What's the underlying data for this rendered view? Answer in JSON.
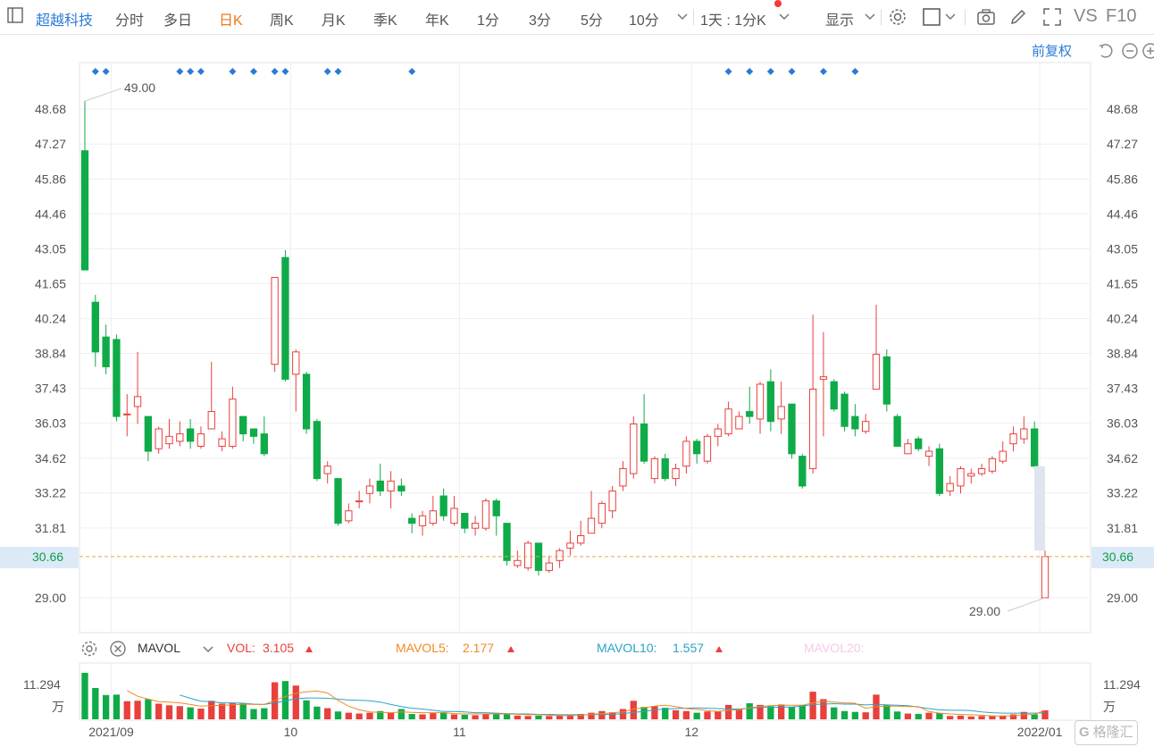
{
  "toolbar": {
    "stock_name": "超越科技",
    "periods": [
      "分时",
      "多日",
      "日K",
      "周K",
      "月K",
      "季K",
      "年K",
      "1分",
      "3分",
      "5分",
      "10分"
    ],
    "selected_period": "日K",
    "interval_select": "1天 : 1分K",
    "display_label": "显示",
    "vs_label": "VS",
    "f10_label": "F10"
  },
  "sub_header": {
    "adjust_label": "前复权"
  },
  "indicator": {
    "name": "MAVOL",
    "vol_label": "VOL:",
    "vol_value": "3.105",
    "mavol5_label": "MAVOL5:",
    "mavol5_value": "2.177",
    "mavol10_label": "MAVOL10:",
    "mavol10_value": "1.557",
    "mavol20_label": "MAVOL20:",
    "volume_max_label": "11.294",
    "volume_unit": "万"
  },
  "current_price_label": "30.66",
  "high_marker_label": "49.00",
  "low_marker_label": "29.00",
  "watermark": "格隆汇",
  "colors": {
    "up": "#e8403c",
    "down": "#0fab49",
    "mavol5": "#f08a24",
    "mavol10": "#2aa3c8",
    "mavol20": "#f7c9e6",
    "accent": "#2b7bd6",
    "selected": "#f07a1a",
    "price_line": "#f0a040"
  },
  "chart_data": {
    "type": "candlestick",
    "y_ticks": [
      48.68,
      47.27,
      45.86,
      44.46,
      43.05,
      41.65,
      40.24,
      38.84,
      37.43,
      36.03,
      34.62,
      33.22,
      31.81,
      29.0
    ],
    "ylim": [
      28.15,
      50.0
    ],
    "x_labels": [
      "2021/09",
      "10",
      "11",
      "12",
      "2022/01"
    ],
    "x_label_index": [
      3,
      20,
      36,
      58,
      91
    ],
    "current_price": 30.66,
    "high": 49.0,
    "low": 29.0,
    "candles": [
      [
        47.0,
        42.2,
        49.0,
        42.2
      ],
      [
        40.9,
        38.9,
        41.2,
        38.3
      ],
      [
        39.5,
        38.3,
        40.0,
        38.0
      ],
      [
        39.4,
        36.3,
        39.6,
        36.1
      ],
      [
        36.4,
        36.4,
        37.2,
        35.5
      ],
      [
        36.7,
        37.1,
        38.9,
        36.0
      ],
      [
        36.3,
        34.9,
        36.3,
        34.5
      ],
      [
        35.0,
        35.8,
        35.9,
        34.8
      ],
      [
        35.2,
        35.5,
        36.2,
        35.0
      ],
      [
        35.3,
        35.6,
        36.1,
        35.1
      ],
      [
        35.8,
        35.3,
        36.2,
        35.0
      ],
      [
        35.1,
        35.6,
        35.9,
        35.0
      ],
      [
        35.8,
        36.5,
        38.5,
        35.9
      ],
      [
        35.1,
        35.4,
        35.7,
        34.9
      ],
      [
        35.1,
        37.0,
        37.5,
        35.0
      ],
      [
        36.3,
        35.6,
        36.3,
        35.3
      ],
      [
        35.8,
        35.5,
        35.8,
        35.2
      ],
      [
        35.6,
        34.8,
        36.3,
        34.7
      ],
      [
        38.4,
        41.9,
        41.9,
        38.1
      ],
      [
        42.7,
        37.8,
        43.0,
        37.7
      ],
      [
        38.0,
        38.9,
        39.0,
        36.5
      ],
      [
        38.0,
        35.8,
        38.1,
        35.6
      ],
      [
        36.1,
        33.8,
        36.2,
        33.7
      ],
      [
        34.0,
        34.3,
        34.5,
        33.6
      ],
      [
        33.8,
        32.0,
        33.8,
        31.9
      ],
      [
        32.1,
        32.5,
        32.8,
        32.0
      ],
      [
        32.9,
        32.9,
        33.3,
        32.6
      ],
      [
        33.2,
        33.5,
        33.8,
        32.8
      ],
      [
        33.7,
        33.3,
        34.4,
        33.1
      ],
      [
        33.3,
        33.7,
        34.1,
        32.6
      ],
      [
        33.5,
        33.3,
        33.8,
        33.1
      ],
      [
        32.2,
        32.0,
        32.4,
        31.6
      ],
      [
        31.9,
        32.3,
        32.5,
        31.5
      ],
      [
        32.0,
        32.5,
        33.1,
        31.9
      ],
      [
        33.1,
        32.3,
        33.4,
        32.1
      ],
      [
        32.0,
        32.6,
        33.1,
        31.9
      ],
      [
        32.4,
        31.8,
        32.4,
        31.6
      ],
      [
        31.8,
        32.0,
        32.3,
        31.5
      ],
      [
        31.8,
        32.9,
        33.0,
        31.7
      ],
      [
        32.9,
        32.3,
        33.0,
        31.5
      ],
      [
        32.0,
        30.5,
        32.0,
        30.3
      ],
      [
        30.3,
        30.5,
        30.9,
        30.2
      ],
      [
        30.2,
        31.2,
        31.3,
        30.1
      ],
      [
        31.2,
        30.1,
        31.2,
        29.9
      ],
      [
        30.1,
        30.4,
        30.7,
        30.0
      ],
      [
        30.5,
        30.9,
        31.0,
        30.2
      ],
      [
        31.0,
        31.2,
        31.7,
        30.7
      ],
      [
        31.2,
        31.5,
        32.1,
        31.1
      ],
      [
        31.6,
        32.2,
        33.3,
        31.6
      ],
      [
        32.0,
        32.8,
        32.9,
        31.8
      ],
      [
        32.5,
        33.3,
        33.5,
        32.2
      ],
      [
        33.5,
        34.2,
        34.5,
        33.3
      ],
      [
        34.0,
        36.0,
        36.3,
        33.8
      ],
      [
        36.0,
        34.5,
        37.2,
        34.4
      ],
      [
        33.8,
        34.6,
        34.7,
        33.6
      ],
      [
        34.6,
        33.8,
        34.8,
        33.7
      ],
      [
        33.8,
        34.2,
        34.4,
        33.5
      ],
      [
        34.3,
        35.3,
        35.5,
        34.0
      ],
      [
        35.3,
        34.8,
        35.4,
        34.4
      ],
      [
        34.5,
        35.5,
        35.6,
        34.4
      ],
      [
        35.5,
        35.8,
        36.0,
        35.1
      ],
      [
        35.6,
        36.6,
        36.9,
        35.5
      ],
      [
        35.8,
        36.3,
        36.5,
        35.8
      ],
      [
        36.5,
        36.3,
        37.5,
        36.0
      ],
      [
        36.2,
        37.6,
        37.7,
        35.6
      ],
      [
        37.7,
        36.1,
        38.2,
        35.7
      ],
      [
        36.2,
        36.7,
        37.7,
        35.6
      ],
      [
        36.8,
        34.8,
        36.8,
        34.6
      ],
      [
        34.7,
        33.5,
        34.8,
        33.4
      ],
      [
        34.2,
        37.4,
        40.4,
        34.0
      ],
      [
        37.8,
        37.9,
        39.7,
        35.5
      ],
      [
        37.7,
        36.6,
        37.8,
        36.5
      ],
      [
        37.2,
        35.9,
        37.3,
        35.7
      ],
      [
        36.3,
        35.8,
        36.8,
        35.5
      ],
      [
        35.7,
        36.1,
        36.4,
        35.6
      ],
      [
        37.4,
        38.8,
        40.8,
        37.4
      ],
      [
        38.7,
        36.8,
        39.0,
        36.5
      ],
      [
        36.3,
        35.1,
        36.4,
        35.1
      ],
      [
        34.8,
        35.2,
        35.4,
        34.9
      ],
      [
        35.4,
        35.0,
        35.5,
        34.9
      ],
      [
        34.7,
        34.9,
        35.1,
        34.3
      ],
      [
        35.0,
        33.2,
        35.2,
        33.1
      ],
      [
        33.3,
        33.6,
        33.9,
        33.1
      ],
      [
        33.5,
        34.2,
        34.3,
        33.2
      ],
      [
        33.9,
        34.0,
        34.2,
        33.6
      ],
      [
        34.0,
        34.2,
        34.4,
        33.9
      ],
      [
        34.1,
        34.6,
        34.7,
        34.0
      ],
      [
        34.5,
        34.9,
        35.3,
        34.4
      ],
      [
        35.2,
        35.6,
        35.9,
        34.9
      ],
      [
        35.4,
        35.8,
        36.3,
        35.2
      ],
      [
        35.8,
        34.3,
        36.1,
        34.2
      ],
      [
        29.0,
        30.66,
        30.9,
        29.0
      ]
    ],
    "volume": [
      11.29,
      7.6,
      5.9,
      6.0,
      4.4,
      4.5,
      4.9,
      3.8,
      3.4,
      3.2,
      2.9,
      2.6,
      4.5,
      3.8,
      3.9,
      3.8,
      2.5,
      2.7,
      9.0,
      9.3,
      8.2,
      4.6,
      3.1,
      2.7,
      1.9,
      1.6,
      1.4,
      1.6,
      2.0,
      1.6,
      2.5,
      1.3,
      1.2,
      1.5,
      1.7,
      1.2,
      1.1,
      1.0,
      1.4,
      1.5,
      1.3,
      0.9,
      0.8,
      0.9,
      0.8,
      0.9,
      1.2,
      1.3,
      1.6,
      2.0,
      1.7,
      2.5,
      4.5,
      3.0,
      3.2,
      2.8,
      2.2,
      2.0,
      1.6,
      1.9,
      1.9,
      3.5,
      2.6,
      3.9,
      3.5,
      3.2,
      3.6,
      3.0,
      3.5,
      6.7,
      4.9,
      2.9,
      2.0,
      1.8,
      1.7,
      6.0,
      3.5,
      1.9,
      1.4,
      1.3,
      1.6,
      1.5,
      0.8,
      0.9,
      0.7,
      0.8,
      0.8,
      0.9,
      1.2,
      1.8,
      1.2,
      2.2
    ],
    "mavol5": [
      null,
      null,
      null,
      null,
      7.0,
      5.6,
      4.9,
      4.3,
      4.2,
      4.0,
      3.6,
      3.2,
      3.3,
      3.4,
      3.5,
      3.7,
      3.6,
      3.6,
      4.6,
      5.5,
      6.3,
      6.7,
      6.9,
      6.4,
      4.6,
      3.2,
      2.3,
      1.8,
      1.7,
      1.6,
      1.8,
      1.7,
      1.6,
      1.6,
      1.6,
      1.4,
      1.3,
      1.3,
      1.3,
      1.3,
      1.3,
      1.2,
      1.1,
      1.1,
      1.0,
      0.9,
      0.9,
      1.0,
      1.2,
      1.4,
      1.6,
      1.8,
      2.5,
      2.8,
      3.2,
      3.4,
      3.1,
      2.6,
      2.4,
      2.1,
      1.9,
      2.2,
      2.3,
      2.8,
      3.1,
      3.3,
      3.4,
      3.4,
      3.4,
      4.0,
      4.4,
      4.2,
      4.0,
      3.9,
      2.7,
      3.1,
      3.2,
      3.2,
      3.1,
      3.1,
      1.9,
      1.5,
      1.3,
      1.2,
      1.1,
      1.0,
      0.8,
      0.8,
      0.9,
      1.1,
      1.2,
      2.177
    ],
    "mavol10": [
      null,
      null,
      null,
      null,
      null,
      null,
      null,
      null,
      null,
      5.9,
      5.1,
      4.4,
      4.3,
      4.0,
      4.0,
      3.9,
      3.7,
      3.6,
      4.0,
      4.5,
      5.0,
      5.2,
      5.2,
      5.1,
      4.9,
      4.7,
      4.6,
      4.5,
      4.2,
      3.6,
      3.1,
      2.7,
      2.5,
      2.2,
      1.9,
      1.9,
      1.8,
      1.6,
      1.6,
      1.5,
      1.4,
      1.3,
      1.3,
      1.2,
      1.2,
      1.1,
      1.1,
      1.1,
      1.1,
      1.2,
      1.2,
      1.4,
      1.7,
      1.9,
      2.3,
      2.5,
      2.6,
      2.7,
      2.8,
      2.7,
      2.6,
      2.5,
      2.5,
      2.7,
      2.9,
      2.9,
      3.0,
      3.0,
      3.2,
      3.6,
      3.7,
      3.8,
      3.7,
      3.7,
      3.5,
      3.6,
      3.5,
      3.4,
      3.3,
      3.0,
      2.6,
      2.3,
      2.2,
      2.2,
      2.1,
      1.8,
      1.6,
      1.5,
      1.5,
      1.5,
      1.5,
      1.557
    ],
    "marker_days": [
      1,
      2,
      9,
      10,
      11,
      14,
      16,
      18,
      19,
      23,
      24,
      31,
      61,
      63,
      65,
      67,
      70,
      73
    ]
  }
}
